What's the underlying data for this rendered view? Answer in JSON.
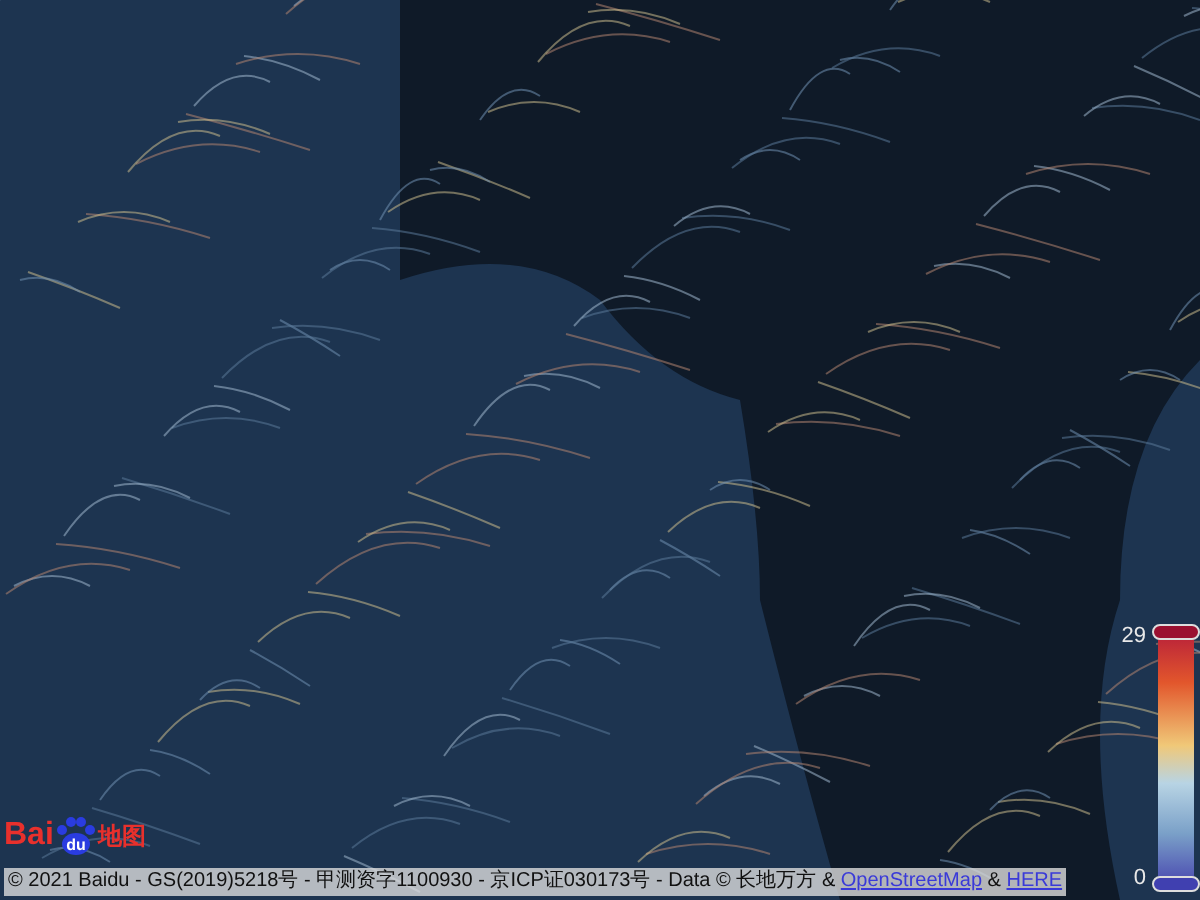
{
  "logo": {
    "prefix": "Bai",
    "badge": "du",
    "suffix": "地图"
  },
  "attribution": {
    "parts": [
      {
        "kind": "text",
        "text": "© 2021 Baidu - GS(2019)5218号 - 甲测资字1100930 - 京ICP证030173号 - Data © 长地万方 & "
      },
      {
        "kind": "link",
        "text": "OpenStreetMap"
      },
      {
        "kind": "text",
        "text": " & "
      },
      {
        "kind": "link",
        "text": "HERE"
      }
    ]
  },
  "legend": {
    "max": "29",
    "min": "0"
  }
}
